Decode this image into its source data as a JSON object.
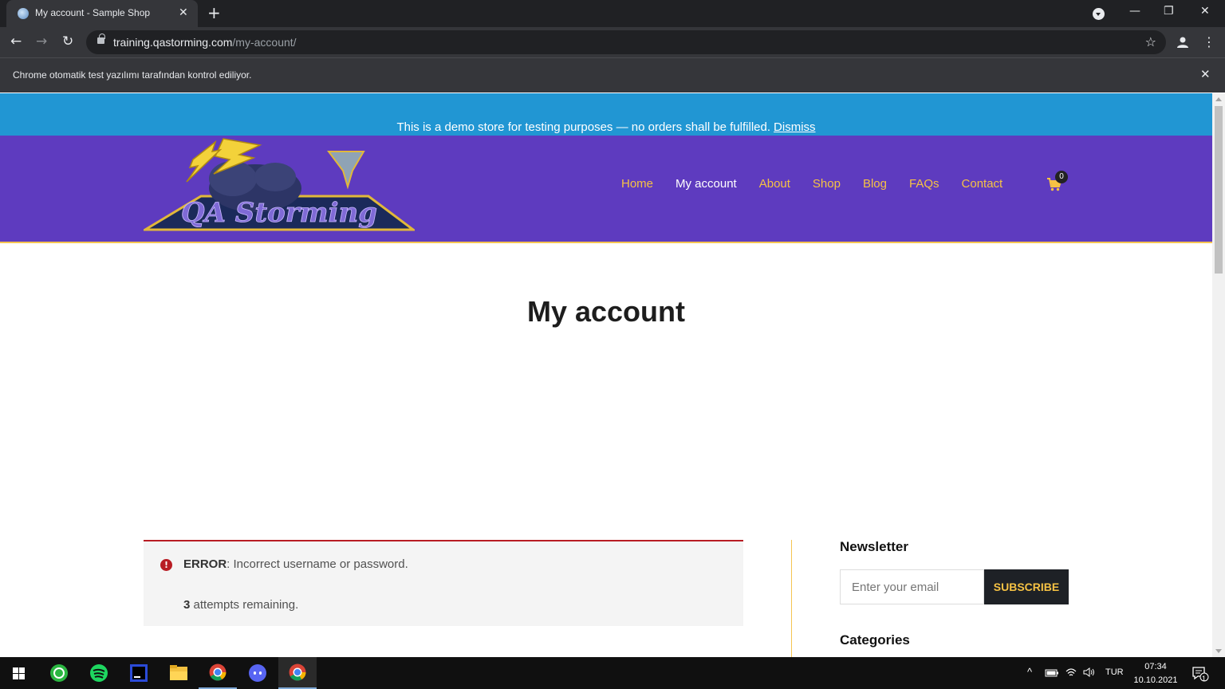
{
  "browser": {
    "tab_title": "My account - Sample Shop",
    "tab_close": "✕",
    "new_tab": "+",
    "url_host": "training.qastorming.com",
    "url_path": "/my-account/",
    "automation_notice": "Chrome otomatik test yazılımı tarafından kontrol ediliyor.",
    "infobar_close": "✕",
    "win_minimize": "—",
    "win_restore": "❐",
    "win_close": "✕",
    "back": "←",
    "forward": "→",
    "reload": "↻",
    "bookmark_star": "☆",
    "menu": "⋮"
  },
  "demo_notice": {
    "text": "This is a demo store for testing purposes — no orders shall be fulfilled.",
    "dismiss": "Dismiss"
  },
  "header": {
    "logo_text": "QA Storming",
    "nav": [
      {
        "label": "Home",
        "active": false
      },
      {
        "label": "My account",
        "active": true
      },
      {
        "label": "About",
        "active": false
      },
      {
        "label": "Shop",
        "active": false
      },
      {
        "label": "Blog",
        "active": false
      },
      {
        "label": "FAQs",
        "active": false
      },
      {
        "label": "Contact",
        "active": false
      }
    ],
    "cart_count": "0"
  },
  "main": {
    "page_title": "My account",
    "error": {
      "label": "ERROR",
      "message": ": Incorrect username or password.",
      "attempts_count": "3",
      "attempts_text": " attempts remaining."
    }
  },
  "sidebar": {
    "newsletter_title": "Newsletter",
    "email_placeholder": "Enter your email",
    "subscribe_label": "SUBSCRIBE",
    "categories_title": "Categories"
  },
  "taskbar": {
    "language": "TUR",
    "time": "07:34",
    "date": "10.10.2021",
    "notifications": "1"
  },
  "colors": {
    "demo_bar": "#2196d3",
    "header": "#5e3bbf",
    "nav_link": "#f6c244",
    "error": "#b81c23"
  }
}
